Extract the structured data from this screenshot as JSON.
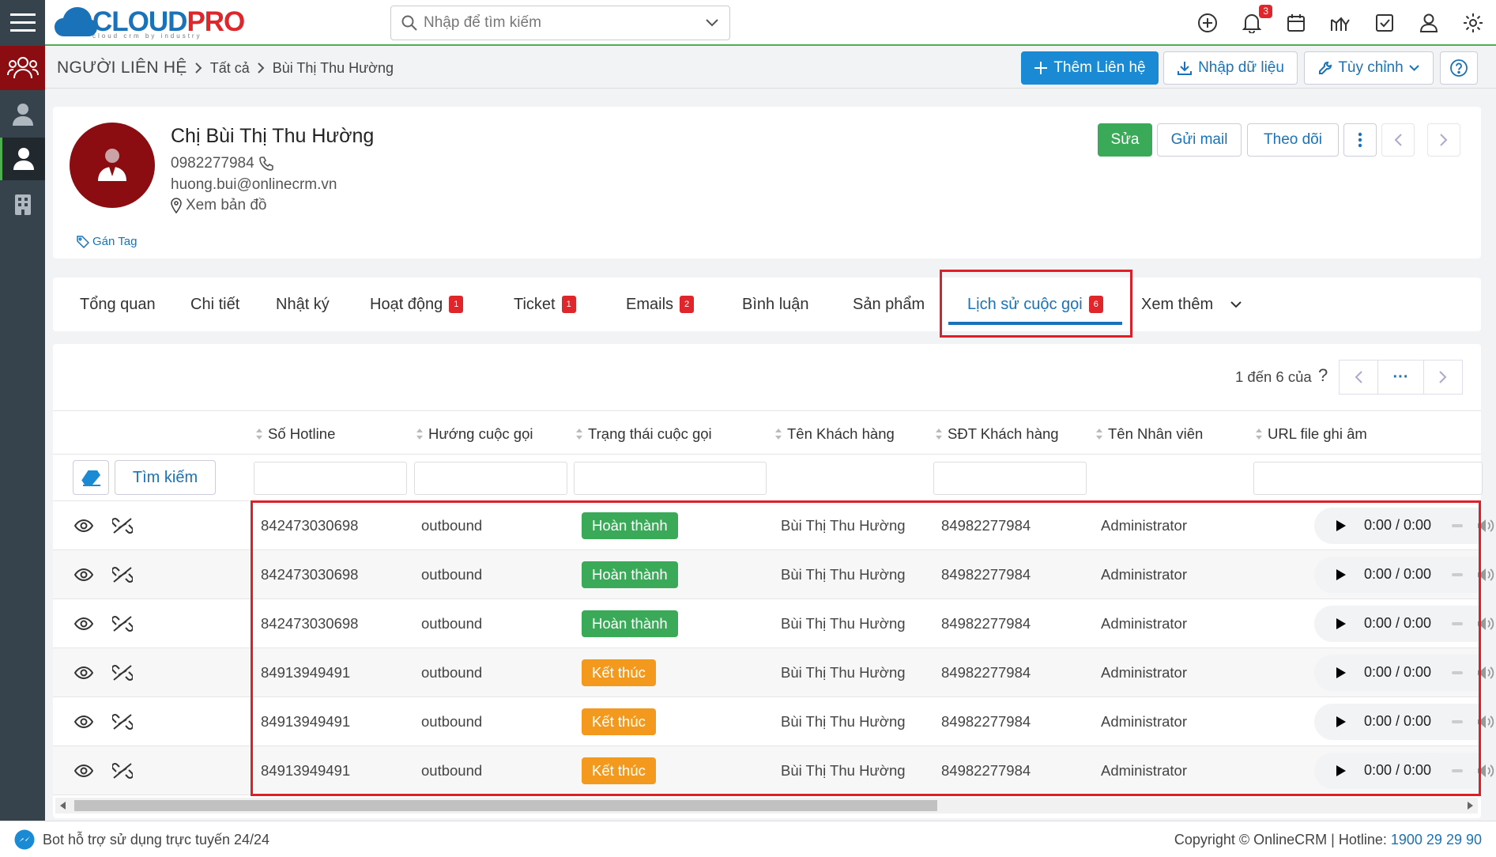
{
  "app": {
    "logo_main": "CLOUD",
    "logo_accent": "PRO",
    "logo_tagline": "cloud crm by industry",
    "notification_count": "3"
  },
  "search": {
    "placeholder": "Nhập để tìm kiếm"
  },
  "breadcrumb": {
    "module": "NGƯỜI LIÊN HỆ",
    "level1": "Tất cả",
    "level2": "Bùi Thị Thu Hường"
  },
  "toolbar": {
    "add_label": "Thêm Liên hệ",
    "import_label": "Nhập dữ liệu",
    "customize_label": "Tùy chỉnh"
  },
  "profile": {
    "name": "Chị Bùi Thị Thu Hường",
    "phone": "0982277984",
    "email": "huong.bui@onlinecrm.vn",
    "map_label": "Xem bản đồ",
    "tag_label": "Gán Tag",
    "edit_label": "Sửa",
    "mail_label": "Gửi mail",
    "follow_label": "Theo dõi"
  },
  "tabs": [
    {
      "label": "Tổng quan"
    },
    {
      "label": "Chi tiết"
    },
    {
      "label": "Nhật ký"
    },
    {
      "label": "Hoạt động",
      "count": "1"
    },
    {
      "label": "Ticket",
      "count": "1"
    },
    {
      "label": "Emails",
      "count": "2"
    },
    {
      "label": "Bình luận"
    },
    {
      "label": "Sản phẩm"
    },
    {
      "label": "Lịch sử cuộc gọi",
      "count": "6"
    },
    {
      "label": "Xem thêm"
    }
  ],
  "pagination": {
    "text": "1 đến 6 của",
    "help": "?",
    "more": "···"
  },
  "table": {
    "search_label": "Tìm kiếm",
    "columns": [
      "Số Hotline",
      "Hướng cuộc gọi",
      "Trạng thái cuộc gọi",
      "Tên Khách hàng",
      "SĐT Khách hàng",
      "Tên Nhân viên",
      "URL file ghi âm"
    ],
    "rows": [
      {
        "hotline": "842473030698",
        "direction": "outbound",
        "status": "Hoàn thành",
        "status_type": "done",
        "customer": "Bùi Thị Thu Hường",
        "phone": "84982277984",
        "staff": "Administrator",
        "audio_time": "0:00 / 0:00"
      },
      {
        "hotline": "842473030698",
        "direction": "outbound",
        "status": "Hoàn thành",
        "status_type": "done",
        "customer": "Bùi Thị Thu Hường",
        "phone": "84982277984",
        "staff": "Administrator",
        "audio_time": "0:00 / 0:00"
      },
      {
        "hotline": "842473030698",
        "direction": "outbound",
        "status": "Hoàn thành",
        "status_type": "done",
        "customer": "Bùi Thị Thu Hường",
        "phone": "84982277984",
        "staff": "Administrator",
        "audio_time": "0:00 / 0:00"
      },
      {
        "hotline": "84913949491",
        "direction": "outbound",
        "status": "Kết thúc",
        "status_type": "end",
        "customer": "Bùi Thị Thu Hường",
        "phone": "84982277984",
        "staff": "Administrator",
        "audio_time": "0:00 / 0:00"
      },
      {
        "hotline": "84913949491",
        "direction": "outbound",
        "status": "Kết thúc",
        "status_type": "end",
        "customer": "Bùi Thị Thu Hường",
        "phone": "84982277984",
        "staff": "Administrator",
        "audio_time": "0:00 / 0:00"
      },
      {
        "hotline": "84913949491",
        "direction": "outbound",
        "status": "Kết thúc",
        "status_type": "end",
        "customer": "Bùi Thị Thu Hường",
        "phone": "84982277984",
        "staff": "Administrator",
        "audio_time": "0:00 / 0:00"
      }
    ]
  },
  "footer": {
    "bot_text": "Bot hỗ trợ sử dụng trực tuyến 24/24",
    "copyright": "Copyright © OnlineCRM | Hotline: ",
    "hotline": "1900 29 29 90"
  },
  "colors": {
    "brand": "#1a73b8",
    "primary_button": "#1a8ad4",
    "success": "#3aaa58",
    "warning": "#f39a1e",
    "danger": "#e0252b",
    "sidebar": "#36434d"
  }
}
